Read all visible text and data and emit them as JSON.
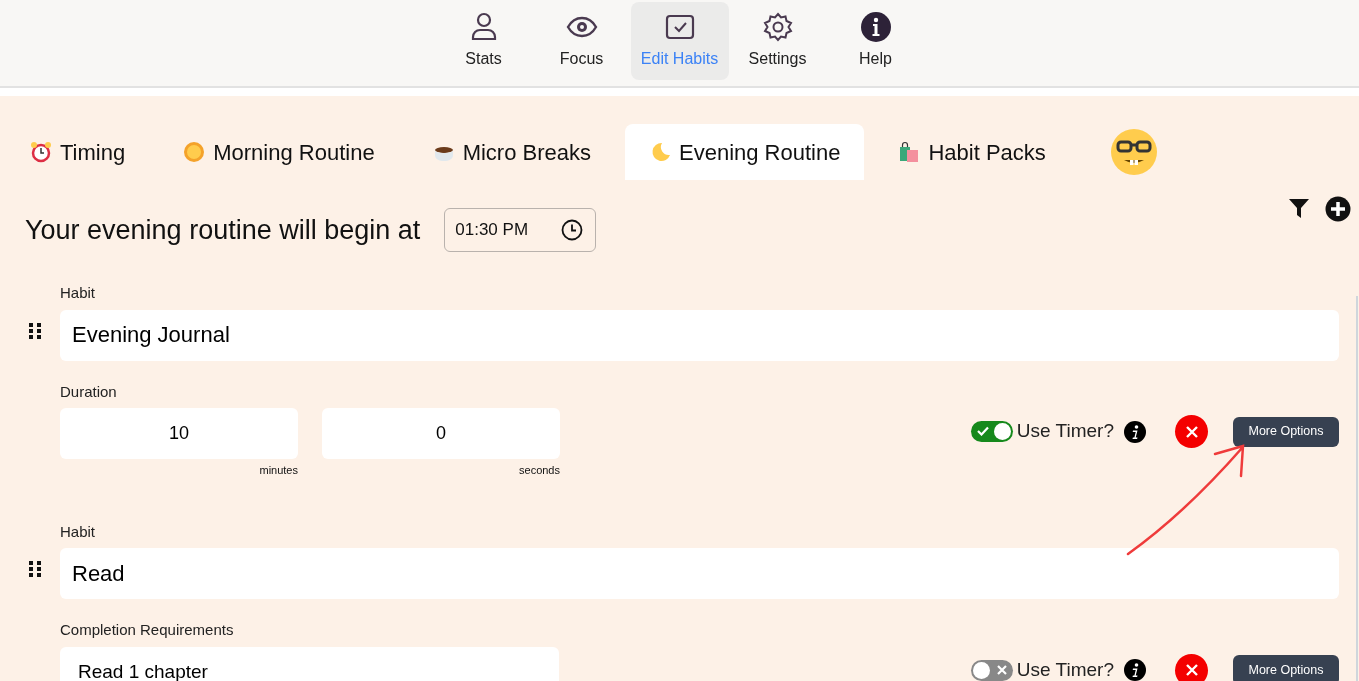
{
  "nav": [
    {
      "label": "Stats",
      "selected": false
    },
    {
      "label": "Focus",
      "selected": false
    },
    {
      "label": "Edit Habits",
      "selected": true
    },
    {
      "label": "Settings",
      "selected": false
    },
    {
      "label": "Help",
      "selected": false
    }
  ],
  "tabs": [
    {
      "label": "Timing",
      "selected": false
    },
    {
      "label": "Morning Routine",
      "selected": false
    },
    {
      "label": "Micro Breaks",
      "selected": false
    },
    {
      "label": "Evening Routine",
      "selected": true
    },
    {
      "label": "Habit Packs",
      "selected": false
    }
  ],
  "heading": "Your evening routine will begin at",
  "start_time": "01:30 PM",
  "habits": [
    {
      "kind": "duration",
      "label": "Habit",
      "name": "Evening Journal",
      "detail_label": "Duration",
      "minutes": "10",
      "minutes_unit": "minutes",
      "seconds": "0",
      "seconds_unit": "seconds",
      "use_timer": true,
      "timer_label": "Use Timer?",
      "more_button": "More Options"
    },
    {
      "kind": "requirements",
      "label": "Habit",
      "name": "Read",
      "detail_label": "Completion Requirements",
      "requirement": "Read 1 chapter",
      "use_timer": false,
      "timer_label": "Use Timer?",
      "more_button": "More Options"
    }
  ]
}
